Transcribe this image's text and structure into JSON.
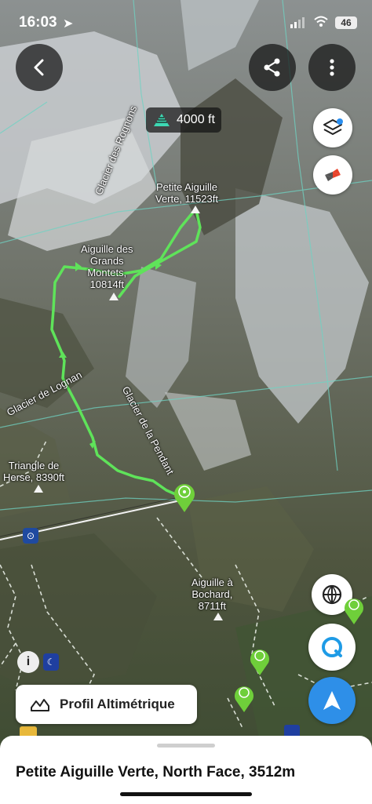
{
  "status_bar": {
    "time": "16:03",
    "battery": "46"
  },
  "map": {
    "altitude_badge": "4000 ft",
    "labels": {
      "glacier_rognons": "Glacier des Rognons",
      "petite_aiguille_verte": [
        "Petite Aiguille",
        "Verte, 11523ft"
      ],
      "aiguille_grands_montets": [
        "Aiguille des",
        "Grands",
        "Montets,",
        "10814ft"
      ],
      "glacier_lognan": "Glacier de Lognan",
      "glacier_pendant": "Glacier de la Pendant",
      "triangle_herse": [
        "Triangle de",
        "Herse, 8390ft"
      ],
      "aiguille_bochard": [
        "Aiguille à",
        "Bochard,",
        "8711ft"
      ]
    },
    "route_color": "#5fe35a",
    "pin_color": "#6fcf3a"
  },
  "buttons": {
    "back": "back",
    "share": "share",
    "more": "more",
    "layers": "layers",
    "compass": "compass",
    "globe": "globe",
    "search_location": "location",
    "navigate": "navigate"
  },
  "profile_button": {
    "label": "Profil Altimétrique"
  },
  "bottom_sheet": {
    "title": "Petite Aiguille Verte, North Face, 3512m"
  }
}
